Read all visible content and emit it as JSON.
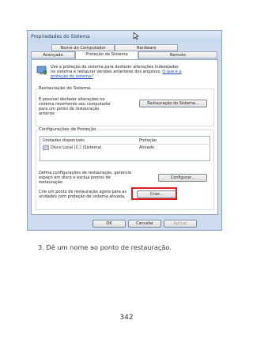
{
  "dialog": {
    "title": "Propriedades do Sistema",
    "tabs": [
      "Nome do Computador",
      "Hardware",
      "Avançado",
      "Proteção do Sistema",
      "Remoto"
    ],
    "intro_line1": "Use a proteção do sistema para desfazer alterações indesejadas",
    "intro_line2": "no sistema e restaurar versões anteriores dos arquivos.",
    "intro_link1": "O que é a",
    "intro_link2": "proteção do sistema?",
    "restore_group": "Restauração do Sistema",
    "restore_text": [
      "É possível desfazer alterações no",
      "sistema revertendo seu computador",
      "para um ponto de restauração",
      "anterior."
    ],
    "restore_button": "Restauração do Sistema...",
    "protection_group": "Configurações de Proteção",
    "col_units": "Unidades disponíveis",
    "col_protection": "Proteção",
    "drive_name": "Disco Local (C:) (Sistema)",
    "drive_status": "Ativado",
    "configure_text": [
      "Defina configurações de restauração, gerencie",
      "espaço em disco e exclua pontos de",
      "restauração."
    ],
    "configure_button": "Configurar...",
    "create_text": [
      "Crie um ponto de restauração agora para as",
      "unidades com proteção de sistema ativada."
    ],
    "create_button": "Criar...",
    "ok": "OK",
    "cancel": "Cancelar",
    "apply": "Aplicar"
  },
  "step_text": "3.  Dê um nome ao ponto de restauração.",
  "page_number": "342",
  "colors": {
    "highlight": "#e02020",
    "title_bg": "#cddcef",
    "link": "#1a4fbf"
  }
}
